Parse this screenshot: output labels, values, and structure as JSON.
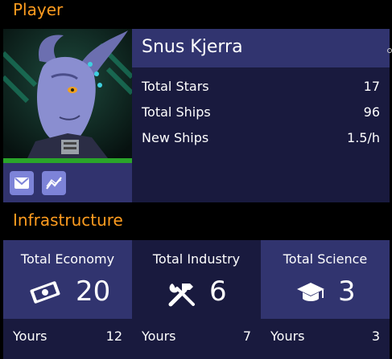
{
  "player": {
    "section_title": "Player",
    "name": "Snus Kjerra",
    "stats": [
      {
        "label": "Total Stars",
        "value": "17"
      },
      {
        "label": "Total Ships",
        "value": "96"
      },
      {
        "label": "New Ships",
        "value": "1.5/h"
      }
    ],
    "actions": [
      {
        "icon": "mail-icon"
      },
      {
        "icon": "chart-icon"
      }
    ]
  },
  "infrastructure": {
    "section_title": "Infrastructure",
    "cards": [
      {
        "title": "Total Economy",
        "icon": "money-icon",
        "value": "20",
        "yours_label": "Yours",
        "yours_value": "12"
      },
      {
        "title": "Total Industry",
        "icon": "tools-icon",
        "value": "6",
        "yours_label": "Yours",
        "yours_value": "7"
      },
      {
        "title": "Total Science",
        "icon": "graduation-cap-icon",
        "value": "3",
        "yours_label": "Yours",
        "yours_value": "3"
      }
    ]
  },
  "colors": {
    "accent": "#ff9c1f",
    "panel_light": "#31346f",
    "panel_dark": "#191a3e",
    "health": "#2aa52a",
    "button": "#7d83d8"
  }
}
